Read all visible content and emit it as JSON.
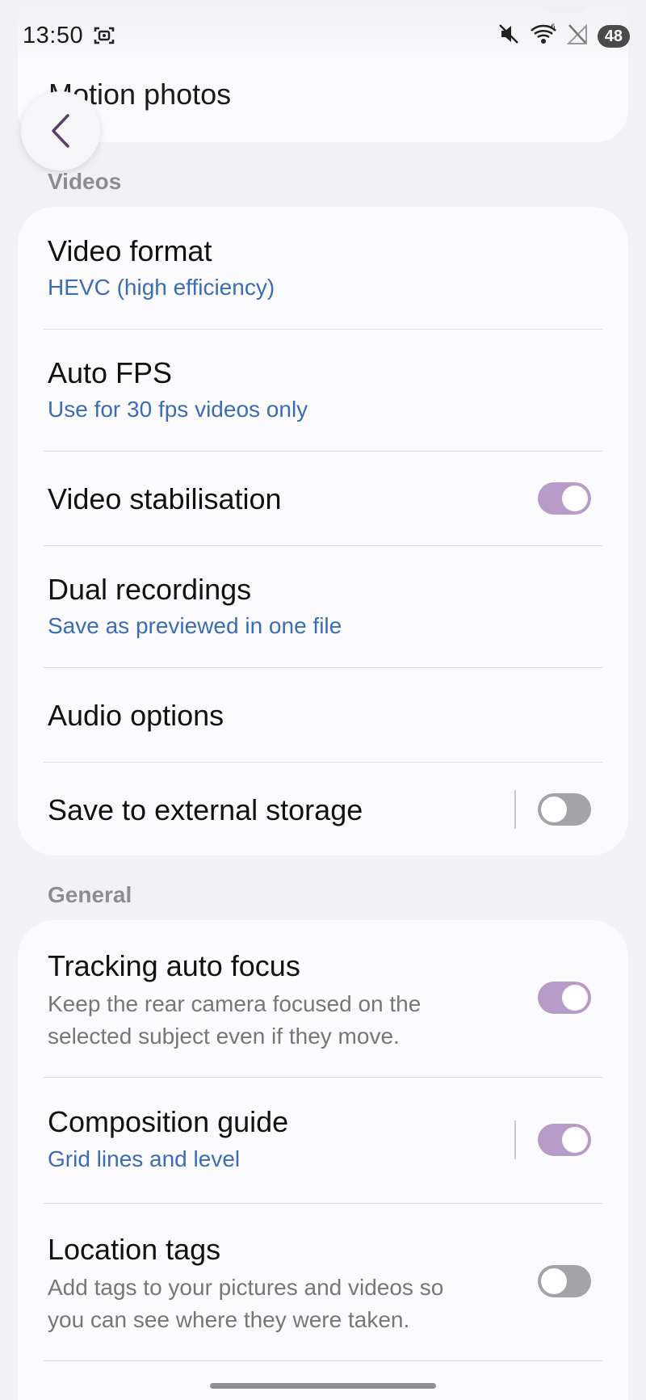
{
  "status_bar": {
    "time": "13:50",
    "battery": "48",
    "icons": [
      "screenshot-icon",
      "mute-icon",
      "wifi-icon",
      "no-signal-icon"
    ]
  },
  "top": {
    "scrolled_title": "Motion photos"
  },
  "sections": {
    "videos_header": "Videos",
    "general_header": "General"
  },
  "videos": {
    "video_format": {
      "title": "Video format",
      "value": "HEVC (high efficiency)"
    },
    "auto_fps": {
      "title": "Auto FPS",
      "value": "Use for 30 fps videos only"
    },
    "video_stabilisation": {
      "title": "Video stabilisation",
      "enabled": true
    },
    "dual_recordings": {
      "title": "Dual recordings",
      "value": "Save as previewed in one file"
    },
    "audio_options": {
      "title": "Audio options"
    },
    "save_external": {
      "title": "Save to external storage",
      "enabled": false
    }
  },
  "general": {
    "tracking_af": {
      "title": "Tracking auto focus",
      "desc_line1": "Keep the rear camera focused on the",
      "desc_line2": "selected subject even if they move.",
      "enabled": true
    },
    "composition_guide": {
      "title": "Composition guide",
      "value": "Grid lines and level",
      "enabled": true
    },
    "location_tags": {
      "title": "Location tags",
      "desc_line1": "Add tags to your pictures and videos so",
      "desc_line2": "you can see where they were taken.",
      "enabled": false
    }
  },
  "colors": {
    "accent_blue": "#3b6cb4",
    "toggle_on": "#b79bc8",
    "toggle_off": "#a3a3a8",
    "background": "#f2f2f6",
    "card": "#fbfbfd"
  }
}
